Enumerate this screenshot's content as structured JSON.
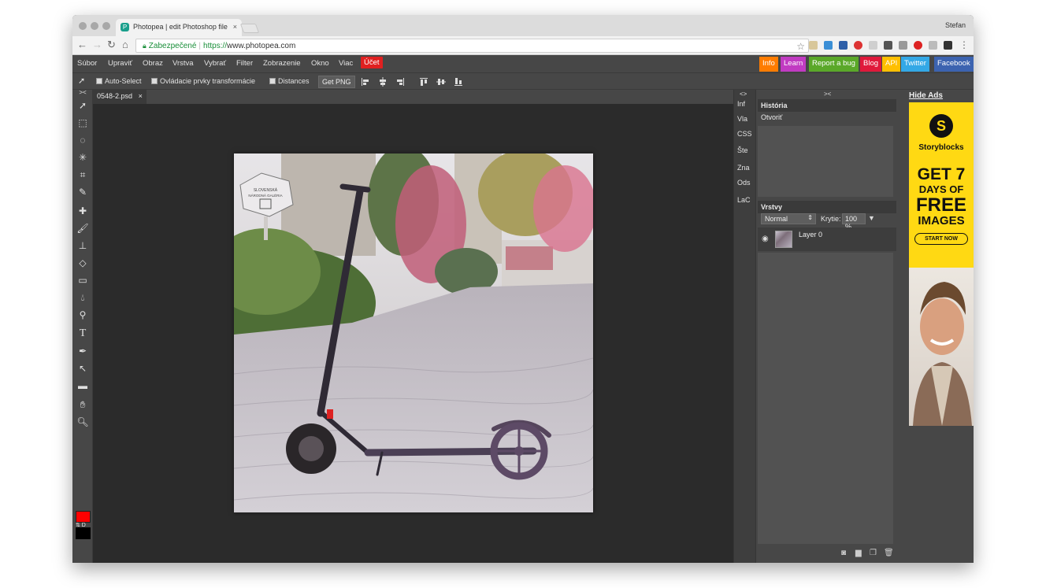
{
  "browser": {
    "tab_title": "Photopea | edit Photoshop file",
    "tab_close": "×",
    "profile_name": "Stefan",
    "secure_label": "Zabezpečené",
    "url_scheme": "https://",
    "url_host": "www.photopea.com"
  },
  "menu": {
    "items": [
      "Súbor",
      "Upraviť",
      "Obraz",
      "Vrstva",
      "Vybrať",
      "Filter",
      "Zobrazenie",
      "Okno",
      "Viac"
    ],
    "account": "Účet",
    "account_color": "#e02020"
  },
  "social": [
    {
      "label": "Info",
      "color": "#ff7c00"
    },
    {
      "label": "Learn",
      "color": "#c13bc2"
    },
    {
      "label": "Report a bug",
      "color": "#5aa829"
    },
    {
      "label": "Blog",
      "color": "#e0193b"
    },
    {
      "label": "API",
      "color": "#ffbf00"
    },
    {
      "label": "Twitter",
      "color": "#33a8e6"
    },
    {
      "label": "Facebook",
      "color": "#3c63b0"
    }
  ],
  "options": {
    "auto_select": "Auto-Select",
    "transform_controls": "Ovládacie prvky transformácie",
    "distances": "Distances",
    "get_png": "Get PNG"
  },
  "document": {
    "tab_label": "0548-2.psd",
    "tab_close": "×",
    "sign_line1": "SLOVENSKÁ",
    "sign_line2": "NÁRODNÁ GALÉRIA"
  },
  "sidestrip": {
    "collapse": "<>",
    "items": [
      "Inf",
      "Vla",
      "CSS",
      "Šte",
      "Zna",
      "Ods",
      "LaC"
    ]
  },
  "panels": {
    "collapse": "><",
    "history_title": "História",
    "history_items": [
      "Otvoriť"
    ],
    "layers_title": "Vrstvy",
    "blend_mode": "Normal",
    "opacity_label": "Krytie:",
    "opacity_value": "100 %",
    "layer_name": "Layer 0"
  },
  "ads": {
    "hide_label": "Hide Ads",
    "brand": "Storyblocks",
    "line1": "GET 7",
    "line2": "DAYS OF",
    "line3": "FREE",
    "line4": "IMAGES",
    "cta": "START NOW",
    "bg_color": "#ffd913"
  },
  "colors": {
    "foreground": "#ff0000",
    "background": "#000000"
  }
}
